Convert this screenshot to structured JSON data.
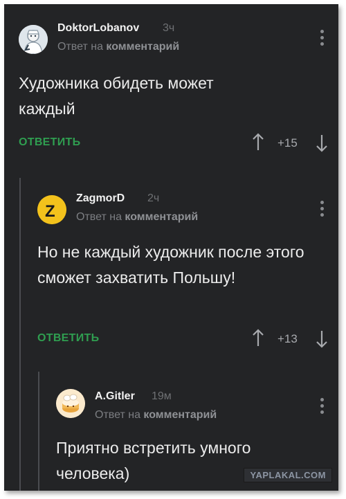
{
  "comments": [
    {
      "username": "DoktorLobanov",
      "time": "3ч",
      "reply_prefix": "Ответ на",
      "reply_target": "комментарий",
      "text": "Художника обидеть может каждый",
      "reply_label": "ОТВЕТИТЬ",
      "score": "+15",
      "avatar_icon": "doctor-avatar"
    },
    {
      "username": "ZagmorD",
      "time": "2ч",
      "reply_prefix": "Ответ на",
      "reply_target": "комментарий",
      "text": "Но не каждый художник после этого сможет захватить Польшу!",
      "reply_label": "ОТВЕТИТЬ",
      "score": "+13",
      "avatar_letter": "Z"
    },
    {
      "username": "A.Gitler",
      "time": "19м",
      "reply_prefix": "Ответ на",
      "reply_target": "комментарий",
      "text": "Приятно встретить умного человека)",
      "avatar_icon": "cake-avatar"
    }
  ],
  "watermark": "YAPLAKAL.COM",
  "colors": {
    "background": "#232426",
    "reply_button": "#2f9e50",
    "avatar_z": "#f3c21c"
  }
}
